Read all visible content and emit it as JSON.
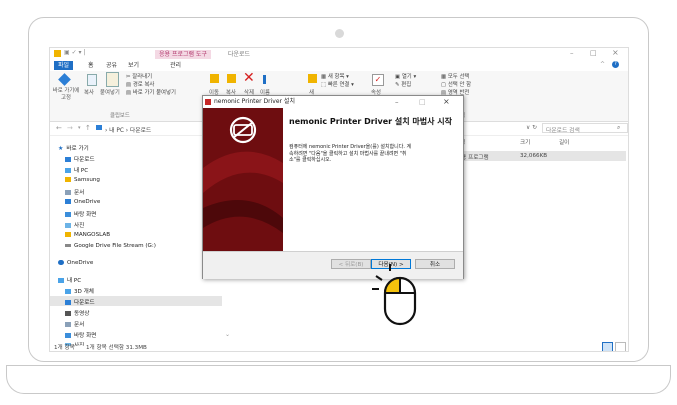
{
  "explorer": {
    "tool_tab": "응용 프로그램 도구",
    "window_title": "다운로드",
    "tabs": [
      "파일",
      "홈",
      "공유",
      "보기",
      "관리"
    ],
    "ribbon": {
      "pin": "바로 가기에 고정",
      "copy": "복사",
      "paste": "붙여넣기",
      "cut": "잘라내기",
      "copy_path": "경로 복사",
      "paste_shortcut": "바로 가기 붙여넣기",
      "clipboard_group": "클립보드",
      "move": "이동",
      "copy_to": "복사",
      "delete": "삭제",
      "rename": "이름",
      "new_folder": "새",
      "new_item": "새 항목",
      "easy_access": "빠른 연결",
      "properties": "속성",
      "open": "열기",
      "edit": "편집",
      "select_all": "모두 선택",
      "select_none": "선택 안 함",
      "invert_selection": "영역 반전",
      "select_group": "선택"
    },
    "address": {
      "path_pc": "내 PC",
      "path_folder": "다운로드",
      "search_placeholder": "다운로드 검색"
    },
    "columns": {
      "type": "형",
      "size": "크기",
      "length": "길이"
    },
    "file_row": {
      "type": "응용 프로그램",
      "size": "32,066KB"
    },
    "nav": {
      "quick_access": "바로 가기",
      "items": [
        "다운로드",
        "내 PC",
        "Samsung",
        "문서",
        "OneDrive",
        "바탕 화면",
        "사진",
        "MANGOSLAB",
        "Google Drive File Stream (G:)"
      ],
      "onedrive": "OneDrive",
      "this_pc": "내 PC",
      "pc_items": [
        "3D 개체",
        "다운로드",
        "동영상",
        "문서",
        "바탕 화면",
        "사진"
      ]
    },
    "status": {
      "count": "1개 항목",
      "selected": "1개 항목 선택함 31.3MB"
    }
  },
  "dialog": {
    "title": "nemonic Printer Driver 설치",
    "heading": "nemonic Printer Driver 설치 마법사 시작",
    "body": "컴퓨터에 nemonic Printer Driver을(를) 설치합니다. 계속하려면 \"다음\"을 클릭하고 설치 마법사를 끝내려면 \"취소\"를 클릭하십시오.",
    "back_button": "< 뒤로(B)",
    "next_button": "다음(N) >",
    "cancel_button": "취소"
  },
  "colors": {
    "explorer_blue": "#1f6fc5",
    "tool_tab_pink": "#f4d9e4",
    "installer_red": "#6e0d10",
    "pointer_yellow": "#f4c20d",
    "accent_focus": "#0078d7"
  }
}
